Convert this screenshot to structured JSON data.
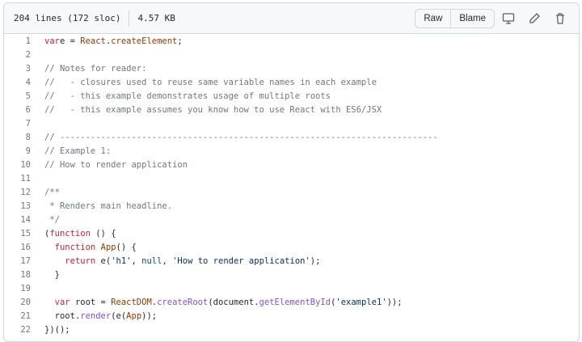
{
  "header": {
    "lines": "204 lines (172 sloc)",
    "size": "4.57 KB",
    "raw": "Raw",
    "blame": "Blame"
  },
  "icons": [
    "display-icon",
    "pencil-icon",
    "trash-icon"
  ],
  "colors": {
    "keyword": "#cf222e",
    "entity": "#953800",
    "function": "#8250df",
    "string": "#0a3069",
    "comment": "#6e7781",
    "constant": "#0550ae"
  },
  "code": [
    [
      [
        "k",
        "var"
      ],
      [
        "",
        "e = "
      ],
      [
        "o",
        "React"
      ],
      [
        "",
        "."
      ],
      [
        "o",
        "createElement"
      ],
      [
        "",
        ";"
      ]
    ],
    [],
    [
      [
        "c",
        "// Notes for reader:"
      ]
    ],
    [
      [
        "c",
        "//   - closures used to reuse same variable names in each example"
      ]
    ],
    [
      [
        "c",
        "//   - this example demonstrates usage of multiple roots"
      ]
    ],
    [
      [
        "c",
        "//   - this example assumes you know how to use React with ES6/JSX"
      ]
    ],
    [],
    [
      [
        "c",
        "// --------------------------------------------------------------------------"
      ]
    ],
    [
      [
        "c",
        "// Example 1:"
      ]
    ],
    [
      [
        "c",
        "// How to render application"
      ]
    ],
    [],
    [
      [
        "c",
        "/**"
      ]
    ],
    [
      [
        "c",
        " * Renders main headline."
      ]
    ],
    [
      [
        "c",
        " */"
      ]
    ],
    [
      [
        "",
        "("
      ],
      [
        "k",
        "function"
      ],
      [
        "",
        " () {"
      ]
    ],
    [
      [
        "",
        "  "
      ],
      [
        "k",
        "function"
      ],
      [
        "",
        ""
      ],
      [
        "o",
        " App"
      ],
      [
        "",
        "() {"
      ]
    ],
    [
      [
        "",
        "    "
      ],
      [
        "k",
        "return"
      ],
      [
        "",
        " e("
      ],
      [
        "s",
        "'h1'"
      ],
      [
        "",
        ", "
      ],
      [
        "n",
        "null"
      ],
      [
        "",
        ", "
      ],
      [
        "s",
        "'How to render application'"
      ],
      [
        "",
        ");"
      ]
    ],
    [
      [
        "",
        "  }"
      ]
    ],
    [],
    [
      [
        "",
        "  "
      ],
      [
        "k",
        "var"
      ],
      [
        "",
        " root = "
      ],
      [
        "o",
        "ReactDOM"
      ],
      [
        "",
        "."
      ],
      [
        "f",
        "createRoot"
      ],
      [
        "",
        "(document."
      ],
      [
        "f",
        "getElementById"
      ],
      [
        "",
        "("
      ],
      [
        "s",
        "'example1'"
      ],
      [
        "",
        "));"
      ]
    ],
    [
      [
        "",
        "  root."
      ],
      [
        "f",
        "render"
      ],
      [
        "",
        "(e("
      ],
      [
        "o",
        "App"
      ],
      [
        "",
        "));"
      ]
    ],
    [
      [
        "",
        "})();"
      ]
    ]
  ]
}
